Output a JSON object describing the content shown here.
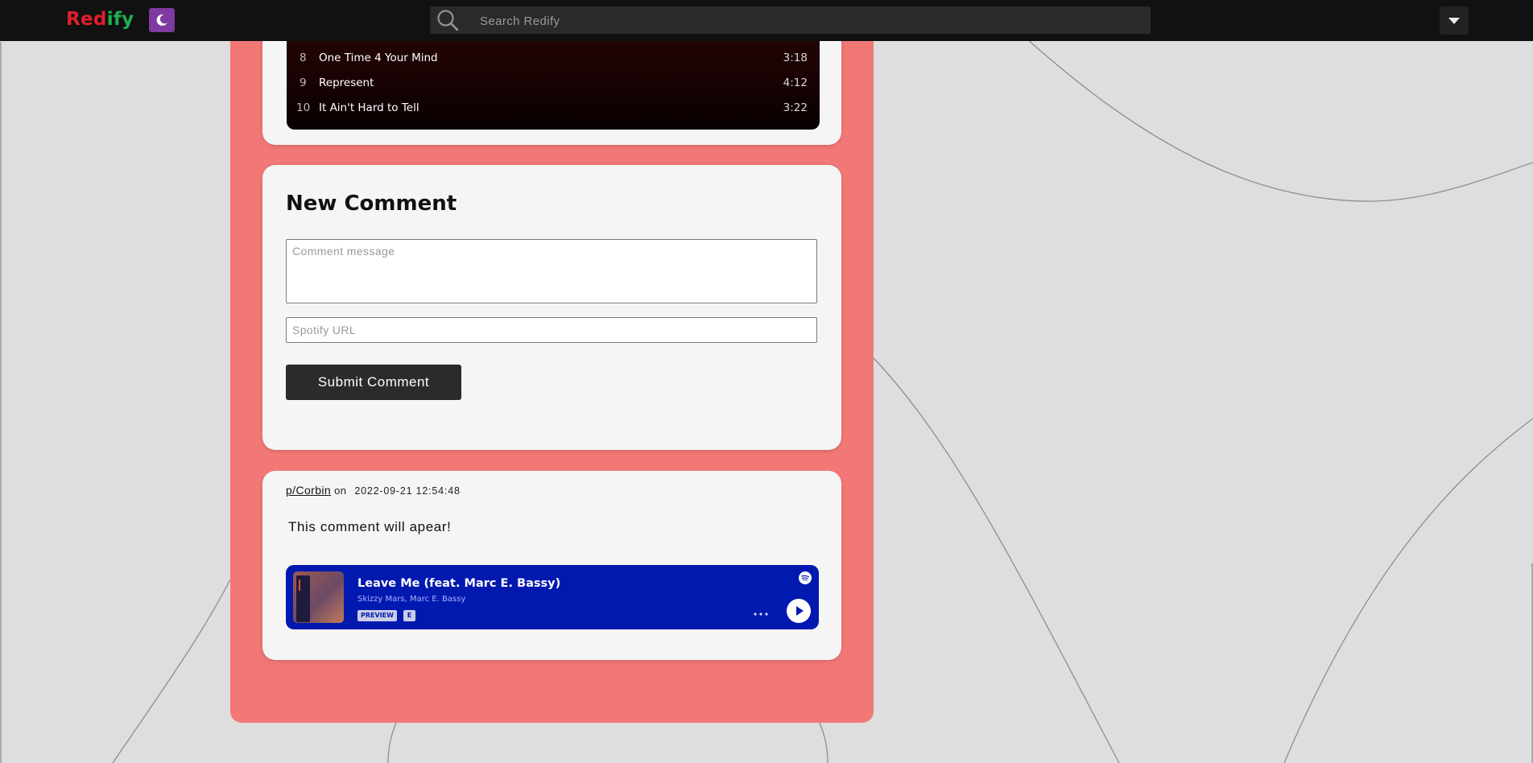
{
  "header": {
    "logo_red": "Red",
    "logo_green": "ify",
    "search_placeholder": "Search Redify"
  },
  "tracklist": {
    "tracks": [
      {
        "num": "8",
        "title": "One Time 4 Your Mind",
        "duration": "3:18"
      },
      {
        "num": "9",
        "title": "Represent",
        "duration": "4:12"
      },
      {
        "num": "10",
        "title": "It Ain't Hard to Tell",
        "duration": "3:22"
      }
    ]
  },
  "new_comment": {
    "title": "New Comment",
    "message_placeholder": "Comment message",
    "url_placeholder": "Spotify URL",
    "submit_label": "Submit Comment"
  },
  "comment": {
    "author": "p/Corbin",
    "on": "on",
    "date": "2022-09-21 12:54:48",
    "body": "This comment will apear!",
    "embed": {
      "title": "Leave Me (feat. Marc E. Bassy)",
      "artists": "Skizzy Mars, Marc E. Bassy",
      "badge_preview": "PREVIEW",
      "badge_explicit": "E"
    }
  },
  "colors": {
    "panel": "#f27777",
    "topbar": "#111111",
    "logo_red": "#e01f2a",
    "logo_green": "#1fb14f",
    "theme_toggle": "#7e3aa0",
    "embed_background": "#0219b0"
  },
  "icons": [
    "moon-icon",
    "search-icon",
    "caret-down-icon",
    "spotify-icon",
    "more-icon",
    "play-icon"
  ]
}
